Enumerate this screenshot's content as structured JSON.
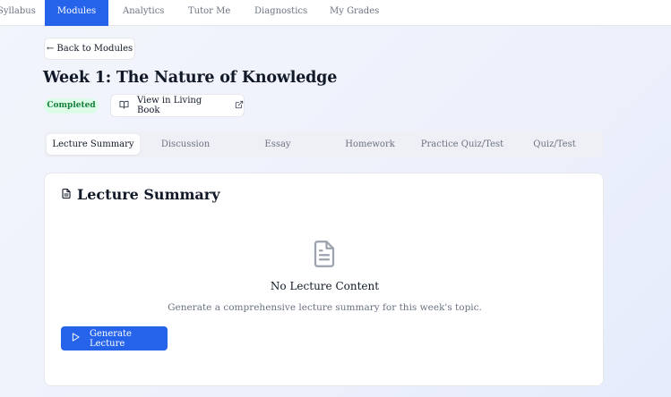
{
  "nav": {
    "items": [
      {
        "label": "Syllabus"
      },
      {
        "label": "Modules"
      },
      {
        "label": "Analytics"
      },
      {
        "label": "Tutor Me"
      },
      {
        "label": "Diagnostics"
      },
      {
        "label": "My Grades"
      }
    ],
    "active": "Modules"
  },
  "back_label": "← Back to Modules",
  "page_title": "Week 1: The Nature of Knowledge",
  "status_badge": "Completed",
  "living_book_label": "View in Living Book",
  "tabs": [
    {
      "label": "Lecture Summary"
    },
    {
      "label": "Discussion"
    },
    {
      "label": "Essay"
    },
    {
      "label": "Homework"
    },
    {
      "label": "Practice Quiz/Test"
    },
    {
      "label": "Quiz/Test"
    }
  ],
  "active_tab": "Lecture Summary",
  "card": {
    "title": "Lecture Summary",
    "empty_title": "No Lecture Content",
    "empty_desc": "Generate a comprehensive lecture summary for this week's topic.",
    "button_label": "Generate Lecture"
  },
  "icons": {
    "back": "arrow-left-icon",
    "book": "book-open-icon",
    "external": "external-link-icon",
    "document": "file-text-icon",
    "play": "play-icon"
  },
  "colors": {
    "accent": "#2563eb",
    "badge_bg": "#dcfce7",
    "badge_text": "#15803d"
  }
}
